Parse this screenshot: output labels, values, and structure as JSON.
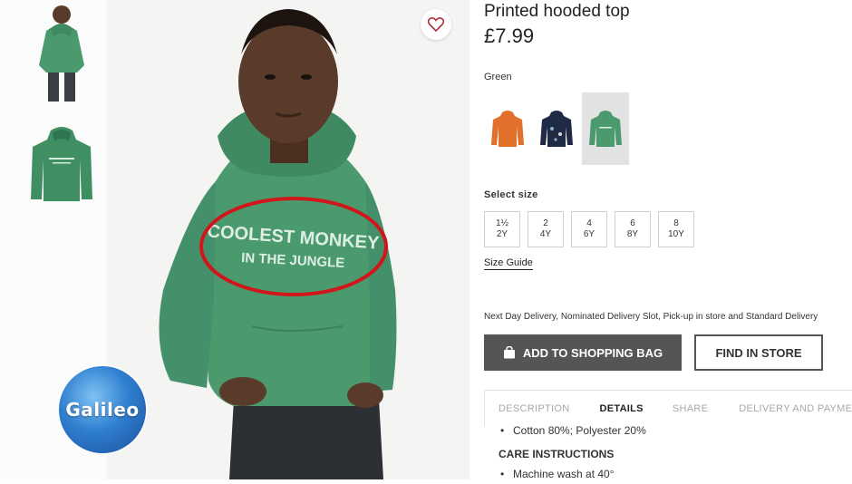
{
  "product": {
    "title": "Printed hooded top",
    "price": "£7.99",
    "print_line1": "COOLEST MONKEY",
    "print_line2": "IN THE JUNGLE"
  },
  "color": {
    "label": "Green",
    "swatches": [
      {
        "name": "orange",
        "hex": "#e0702a"
      },
      {
        "name": "navy",
        "hex": "#1f2a44"
      },
      {
        "name": "green",
        "hex": "#4a9a6e",
        "selected": true
      }
    ]
  },
  "sizes": {
    "label": "Select size",
    "options": [
      "1½\n2Y",
      "2\n4Y",
      "4\n6Y",
      "6\n8Y",
      "8\n10Y"
    ],
    "guide": "Size Guide"
  },
  "delivery_text": "Next Day Delivery, Nominated Delivery Slot, Pick-up in store and Standard Delivery",
  "actions": {
    "add_to_bag": "ADD TO SHOPPING BAG",
    "find_in_store": "FIND IN STORE"
  },
  "tabs": [
    "DESCRIPTION",
    "DETAILS",
    "SHARE",
    "DELIVERY AND PAYMENT"
  ],
  "details": {
    "composition": "Cotton 80%; Polyester 20%",
    "care_heading": "CARE INSTRUCTIONS",
    "care_item": "Machine wash at 40°"
  },
  "logo": {
    "text": "Galileo"
  },
  "colors": {
    "annotation_circle": "#d0161b",
    "hoodie_green": "#4a9a6e",
    "button_gray": "#555555"
  }
}
